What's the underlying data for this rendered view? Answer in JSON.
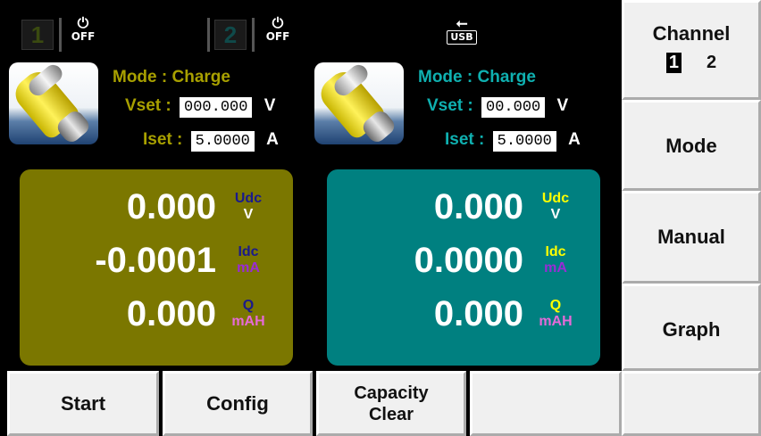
{
  "status_bar": {
    "channel1_number": "1",
    "channel1_power": "OFF",
    "channel2_number": "2",
    "channel2_power": "OFF",
    "usb_label": "USB"
  },
  "channel1": {
    "mode_label": "Mode : ",
    "mode_value": "Charge",
    "vset_label": "Vset :",
    "vset_value": "000.000",
    "vset_unit": "V",
    "iset_label": "Iset :",
    "iset_value": "5.0000",
    "iset_unit": "A",
    "voltage": "0.000",
    "voltage_label": "Udc",
    "voltage_unit": "V",
    "current": "-0.0001",
    "current_label": "Idc",
    "current_unit": "mA",
    "capacity": "0.000",
    "capacity_label": "Q",
    "capacity_unit": "mAH"
  },
  "channel2": {
    "mode_label": "Mode : ",
    "mode_value": "Charge",
    "vset_label": "Vset :",
    "vset_value": "00.000",
    "vset_unit": "V",
    "iset_label": "Iset :",
    "iset_value": "5.0000",
    "iset_unit": "A",
    "voltage": "0.000",
    "voltage_label": "Udc",
    "voltage_unit": "V",
    "current": "0.0000",
    "current_label": "Idc",
    "current_unit": "mA",
    "capacity": "0.000",
    "capacity_label": "Q",
    "capacity_unit": "mAH"
  },
  "menu": {
    "channel_label": "Channel",
    "channel_opt1": "1",
    "channel_opt2": "2",
    "mode_label": "Mode",
    "manual_label": "Manual",
    "graph_label": "Graph"
  },
  "softkeys": {
    "start": "Start",
    "config": "Config",
    "capacity_clear_line1": "Capacity",
    "capacity_clear_line2": "Clear"
  },
  "colors": {
    "channel1_panel": "#7b7700",
    "channel2_panel": "#008080",
    "label_yellow": "#ffff00",
    "label_purple": "#9a2bd6",
    "label_navy": "#1a1a8c"
  }
}
